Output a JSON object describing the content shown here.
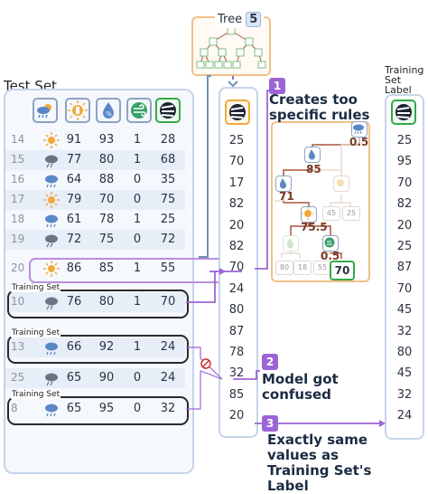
{
  "tree_label": "Tree",
  "tree_number": "5",
  "test_set_title": "Test Set",
  "training_label_title": [
    "Training",
    "Set",
    "Label"
  ],
  "feature_icons": [
    "weather-rain-icon",
    "sun-temperature-icon",
    "humidity-drop-icon",
    "wind-icon",
    "play-golf-label-icon"
  ],
  "rows": [
    {
      "id": "14",
      "icon": "sun-icon",
      "temp": "91",
      "hum": "93",
      "wind": "1",
      "label": "28"
    },
    {
      "id": "15",
      "icon": "rain-cloud-icon",
      "temp": "77",
      "hum": "80",
      "wind": "1",
      "label": "68"
    },
    {
      "id": "16",
      "icon": "cloud-icon",
      "temp": "64",
      "hum": "88",
      "wind": "0",
      "label": "35"
    },
    {
      "id": "17",
      "icon": "sun-icon",
      "temp": "79",
      "hum": "70",
      "wind": "0",
      "label": "75"
    },
    {
      "id": "18",
      "icon": "cloud-icon",
      "temp": "61",
      "hum": "78",
      "wind": "1",
      "label": "25"
    },
    {
      "id": "19",
      "icon": "rain-cloud-icon",
      "temp": "72",
      "hum": "75",
      "wind": "0",
      "label": "72"
    },
    {
      "id": "20",
      "icon": "sun-icon",
      "temp": "86",
      "hum": "85",
      "wind": "1",
      "label": "55"
    },
    {
      "id": "10",
      "icon": "rain-cloud-icon",
      "temp": "76",
      "hum": "80",
      "wind": "1",
      "label": "70"
    },
    {
      "id": "",
      "icon": "",
      "temp": "",
      "hum": "",
      "wind": "",
      "label": ""
    },
    {
      "id": "13",
      "icon": "cloud-icon",
      "temp": "66",
      "hum": "92",
      "wind": "1",
      "label": "24"
    },
    {
      "id": "",
      "icon": "",
      "temp": "",
      "hum": "",
      "wind": "",
      "label": ""
    },
    {
      "id": "25",
      "icon": "rain-cloud-icon",
      "temp": "65",
      "hum": "90",
      "wind": "0",
      "label": "24"
    },
    {
      "id": "8",
      "icon": "cloud-icon",
      "temp": "65",
      "hum": "95",
      "wind": "0",
      "label": "32"
    }
  ],
  "training_set_tag": "Training Set",
  "prediction_column": [
    "25",
    "70",
    "17",
    "82",
    "20",
    "82",
    "70",
    "24",
    "80",
    "87",
    "78",
    "32",
    "85",
    "20"
  ],
  "training_label_column": [
    "25",
    "95",
    "70",
    "82",
    "20",
    "25",
    "87",
    "70",
    "45",
    "32",
    "80",
    "45",
    "32",
    "24"
  ],
  "tree_thresholds": [
    "0.5",
    "85",
    "71",
    "75.5",
    "0.5"
  ],
  "tree_leaves": [
    "45",
    "25",
    "80",
    "18",
    "55",
    "70"
  ],
  "notes": [
    {
      "num": "1",
      "text": "Creates too specific rules"
    },
    {
      "num": "2",
      "text": "Model got confused"
    },
    {
      "num": "3",
      "text": "Exactly same values as Training Set's Label"
    }
  ]
}
